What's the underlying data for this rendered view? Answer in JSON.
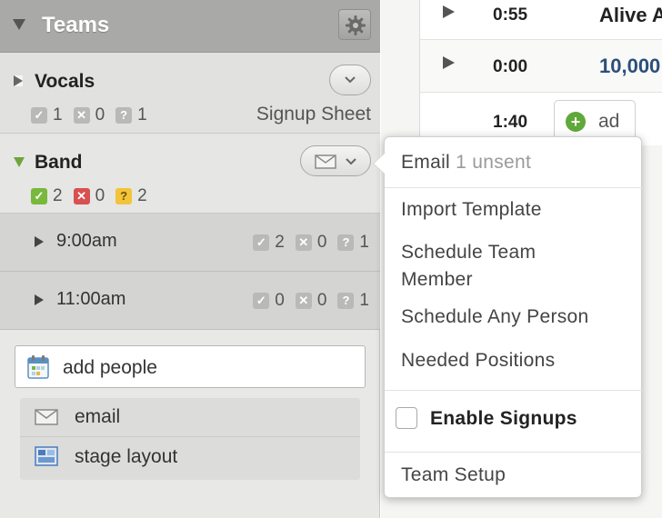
{
  "teams_panel": {
    "title": "Teams",
    "teams": [
      {
        "name": "Vocals",
        "counts": {
          "confirmed": "1",
          "declined": "0",
          "unconfirmed": "1"
        },
        "signup_link": "Signup Sheet"
      },
      {
        "name": "Band",
        "counts": {
          "confirmed": "2",
          "declined": "0",
          "unconfirmed": "2"
        },
        "times": [
          {
            "label": "9:00am",
            "counts": {
              "confirmed": "2",
              "declined": "0",
              "unconfirmed": "1"
            }
          },
          {
            "label": "11:00am",
            "counts": {
              "confirmed": "0",
              "declined": "0",
              "unconfirmed": "1"
            }
          }
        ]
      }
    ],
    "add_people": "add people",
    "actions": {
      "email": "email",
      "stage_layout": "stage layout"
    },
    "badge_glyphs": {
      "confirmed": "✓",
      "declined": "✕",
      "unconfirmed": "?"
    }
  },
  "schedule": {
    "rows": [
      {
        "duration": "0:55",
        "title": "Alive A"
      },
      {
        "duration": "0:00",
        "title": "10,000"
      },
      {
        "duration": "1:40",
        "title": ""
      }
    ],
    "add_label": "ad"
  },
  "dropdown": {
    "email_label": "Email",
    "email_status": "1 unsent",
    "import_template": "Import Template",
    "schedule_team_member_line1": "Schedule Team",
    "schedule_team_member_line2": "Member",
    "schedule_any_person": "Schedule Any Person",
    "needed_positions": "Needed Positions",
    "enable_signups": "Enable Signups",
    "team_setup": "Team Setup"
  },
  "colors": {
    "confirmed": "#78b83c",
    "declined": "#d85050",
    "unconfirmed": "#f3c33a",
    "expanded_caret": "#6fa43a",
    "key_text": "#2b4f7a"
  },
  "icons": [
    "gear-icon",
    "chevron-down-icon",
    "envelope-icon",
    "calendar-icon",
    "stage-layout-icon",
    "plus-icon",
    "play-icon"
  ]
}
